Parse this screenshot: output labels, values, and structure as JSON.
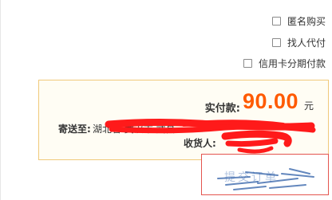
{
  "options": {
    "anonymous": "匿名购买",
    "proxy_pay": "找人代付",
    "credit_installment": "信用卡分期付款"
  },
  "summary": {
    "pay_label": "实付款:",
    "amount": "90.00",
    "unit": "元",
    "address_label": "寄送至:",
    "address_value": "湖北省 武汉市 武昌",
    "receiver_label": "收货人:",
    "receiver_value": ""
  },
  "submit": {
    "label": "提交订单"
  },
  "colors": {
    "amount": "#ff5a00",
    "summary_border": "#f0c97a",
    "summary_bg": "#fffdf4",
    "redaction": "#ff1a1a",
    "submit_border": "#e4554f"
  }
}
